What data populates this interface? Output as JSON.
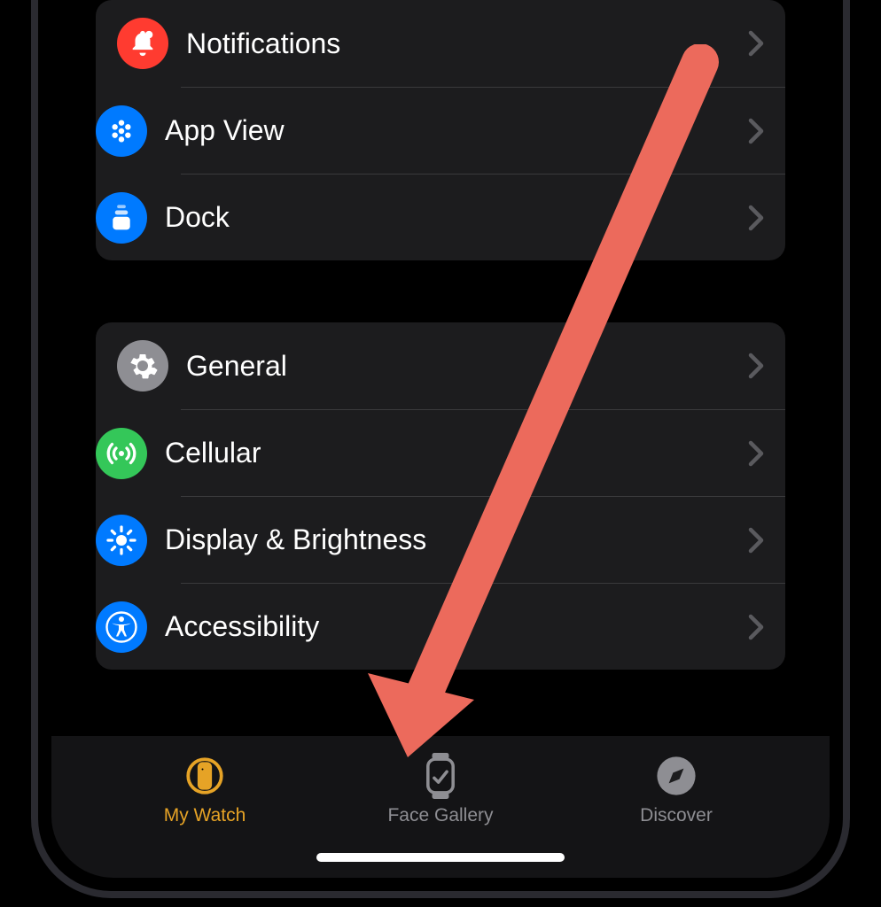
{
  "group1": {
    "items": [
      {
        "label": "Notifications",
        "icon": "bell",
        "color": "red"
      },
      {
        "label": "App View",
        "icon": "apps",
        "color": "blue"
      },
      {
        "label": "Dock",
        "icon": "dock",
        "color": "blue"
      }
    ]
  },
  "group2": {
    "items": [
      {
        "label": "General",
        "icon": "gear",
        "color": "gray"
      },
      {
        "label": "Cellular",
        "icon": "cellular",
        "color": "green"
      },
      {
        "label": "Display & Brightness",
        "icon": "brightness",
        "color": "blue"
      },
      {
        "label": "Accessibility",
        "icon": "accessibility",
        "color": "blue"
      }
    ]
  },
  "tabs": {
    "my_watch": "My Watch",
    "face_gallery": "Face Gallery",
    "discover": "Discover"
  },
  "colors": {
    "accent": "#e6a326",
    "red": "#ff3b30",
    "blue": "#007aff",
    "green": "#34c759",
    "gray": "#8e8e93"
  }
}
